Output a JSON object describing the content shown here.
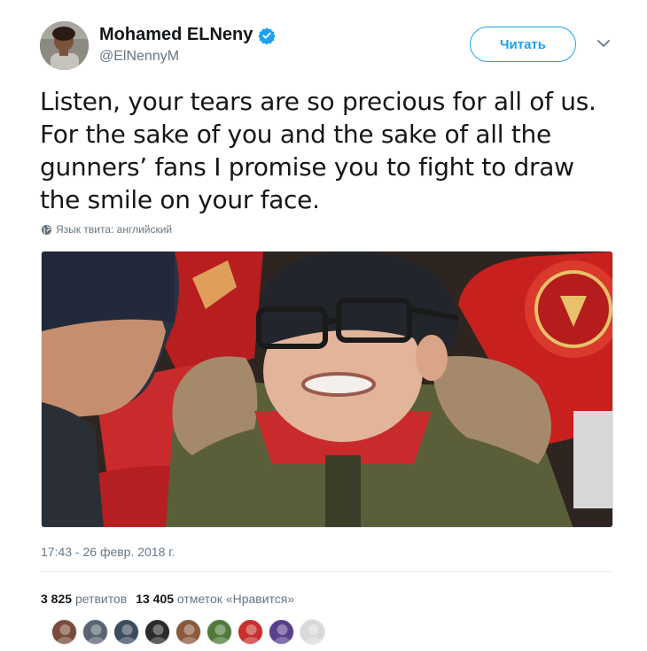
{
  "author": {
    "name": "Mohamed ELNeny",
    "handle": "@ElNennyM",
    "verified": true,
    "avatar_icon": "profile-photo"
  },
  "follow_button": {
    "label": "Читать"
  },
  "menu_icon": "chevron-down-icon",
  "tweet": {
    "lines": [
      "Listen, your tears are so precious for all of us.",
      "For the sake of you and the sake of all the",
      "gunners’ fans I promise you to fight to draw",
      "the smile on your face."
    ],
    "language_note": "Язык твита: английский"
  },
  "media": {
    "icon": "photo-crying-boy-in-stadium"
  },
  "timestamp": "17:43 - 26 февр. 2018 г.",
  "stats": {
    "retweets_count": "3 825",
    "retweets_label": "ретвитов",
    "likes_count": "13 405",
    "likes_label": "отметок «Нравится»"
  },
  "likers": [
    {
      "color": "#7a4b3a"
    },
    {
      "color": "#5b6470"
    },
    {
      "color": "#3d4c5c"
    },
    {
      "color": "#2b2b2b"
    },
    {
      "color": "#8a5a3b"
    },
    {
      "color": "#4f7a3a"
    },
    {
      "color": "#c9302c"
    },
    {
      "color": "#5a3f8c"
    },
    {
      "color": "#d9d9d9"
    }
  ],
  "colors": {
    "accent": "#1da1f2",
    "muted": "#657786",
    "text": "#14171a"
  }
}
